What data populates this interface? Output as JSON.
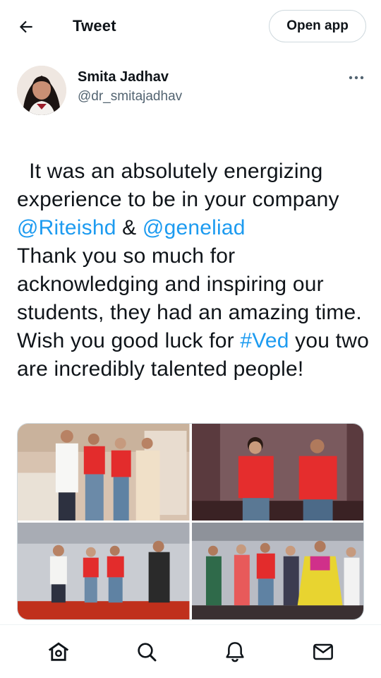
{
  "header": {
    "title": "Tweet",
    "open_app_label": "Open app",
    "back_icon": "arrow-left-icon"
  },
  "author": {
    "name": "Smita Jadhav",
    "handle": "@dr_smitajadhav",
    "more_icon": "more-horizontal-icon"
  },
  "tweet": {
    "segments": [
      {
        "text": "It was an absolutely energizing experience to be in your company ",
        "type": "text"
      },
      {
        "text": "@Riteishd",
        "type": "mention"
      },
      {
        "text": " & ",
        "type": "text"
      },
      {
        "text": "@geneliad",
        "type": "mention"
      },
      {
        "text": "\nThank you so much for acknowledging and inspiring our students, they had an amazing time.\nWish you good luck for ",
        "type": "text"
      },
      {
        "text": "#Ved",
        "type": "hashtag"
      },
      {
        "text": " you two are incredibly talented people!",
        "type": "text"
      }
    ]
  },
  "media": {
    "photos": [
      {
        "name": "photo-group-posing"
      },
      {
        "name": "photo-two-on-stage"
      },
      {
        "name": "photo-stage-speech"
      },
      {
        "name": "photo-students-dancing"
      }
    ]
  },
  "nav": {
    "items": [
      {
        "icon": "home-icon"
      },
      {
        "icon": "search-icon"
      },
      {
        "icon": "bell-icon"
      },
      {
        "icon": "mail-icon"
      }
    ]
  },
  "colors": {
    "link": "#1d9bf0",
    "text": "#0f1419",
    "secondary": "#536471",
    "border": "#cfd9de"
  }
}
